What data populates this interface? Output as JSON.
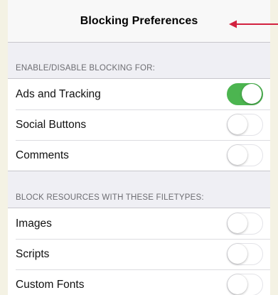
{
  "navbar": {
    "title": "Blocking Preferences"
  },
  "sections": [
    {
      "header": "ENABLE/DISABLE BLOCKING FOR:",
      "rows": [
        {
          "label": "Ads and Tracking",
          "on": true
        },
        {
          "label": "Social Buttons",
          "on": false
        },
        {
          "label": "Comments",
          "on": false
        }
      ]
    },
    {
      "header": "BLOCK RESOURCES WITH THESE FILETYPES:",
      "rows": [
        {
          "label": "Images",
          "on": false
        },
        {
          "label": "Scripts",
          "on": false
        },
        {
          "label": "Custom Fonts",
          "on": false
        }
      ]
    }
  ],
  "colors": {
    "toggle_on": "#4cb550",
    "annotation_arrow": "#d2213f",
    "page_background": "#f4f2e4"
  },
  "annotation": {
    "arrow_icon": "left-arrow-icon"
  }
}
